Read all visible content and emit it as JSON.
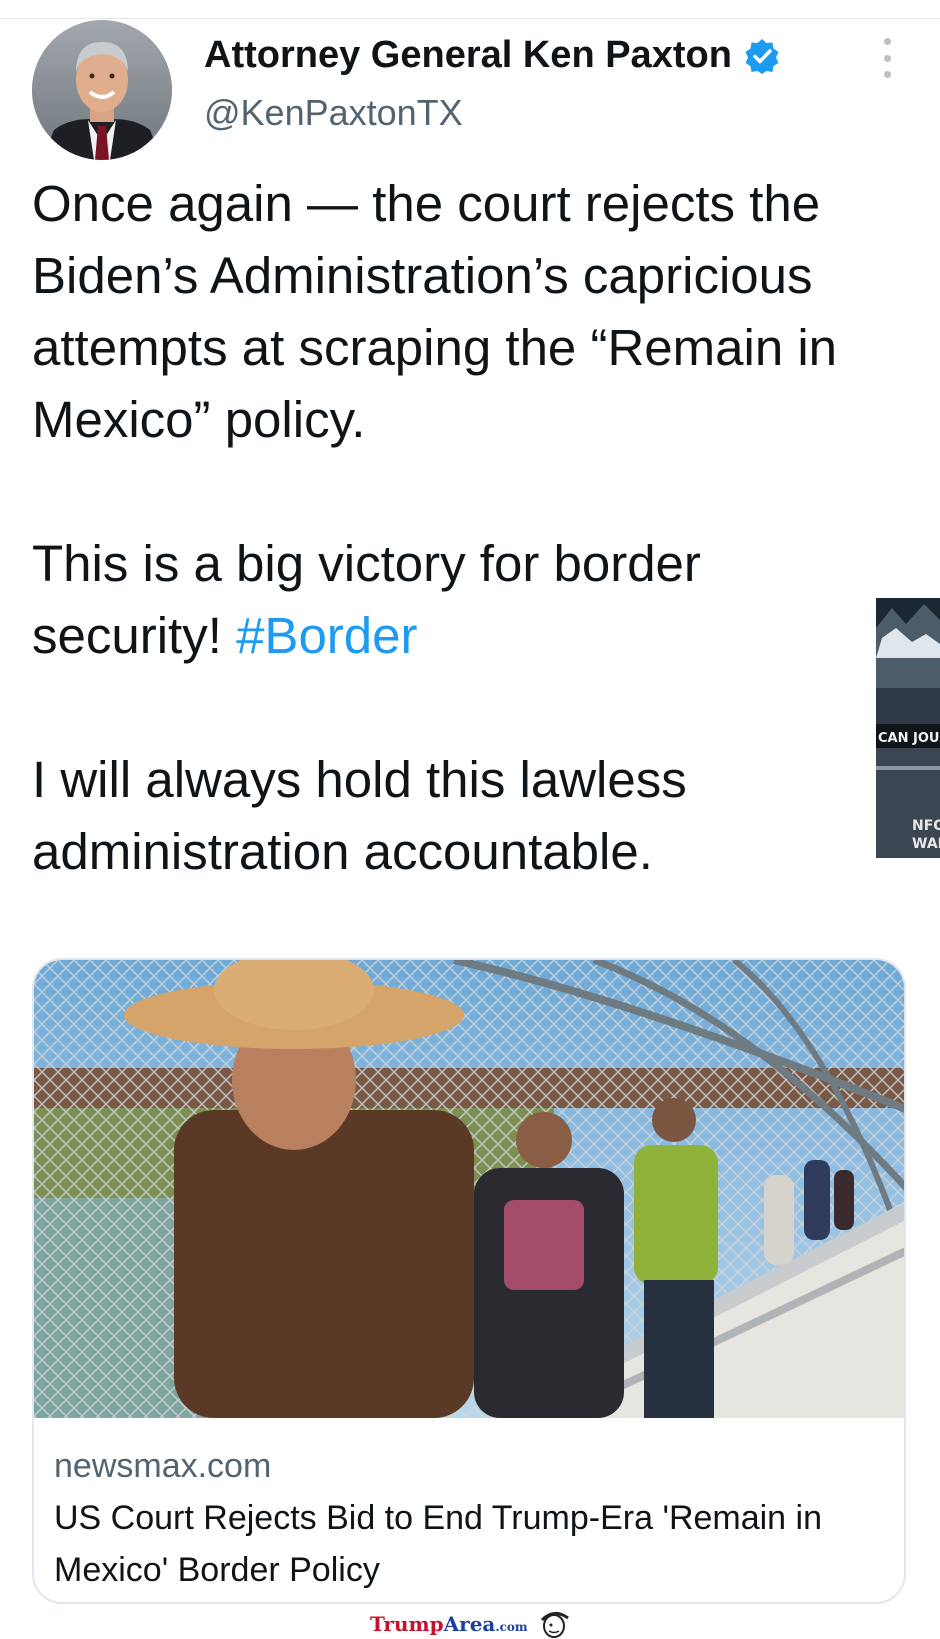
{
  "tweet": {
    "display_name": "Attorney General Ken Paxton",
    "handle": "@KenPaxtonTX",
    "verified_icon": "verified-badge-icon",
    "more_icon": "more-options-icon",
    "paragraphs": [
      {
        "text": "Once again — the court rejects the Biden’s Administration’s capricious attempts at scraping the “Remain in Mexico” policy."
      },
      {
        "text": "This is a big victory for border security! ",
        "hashtag": "#Border"
      },
      {
        "text": "I will always hold this lawless administration accountable."
      }
    ],
    "link_card": {
      "domain": "newsmax.com",
      "title": "US Court Rejects Bid to End Trump-Era 'Remain in Mexico' Border Policy"
    },
    "side_image": {
      "caption_top": "CAN JOUR",
      "caption_bottom_1": "NFO",
      "caption_bottom_2": "WARS"
    }
  },
  "watermark": {
    "brand_a": "Trump",
    "brand_b": "Area",
    "brand_c": ".com"
  },
  "colors": {
    "link_blue": "#1d9bf0",
    "secondary_text": "#536471",
    "watermark_red": "#c8102e",
    "watermark_blue": "#1a3f9c"
  }
}
